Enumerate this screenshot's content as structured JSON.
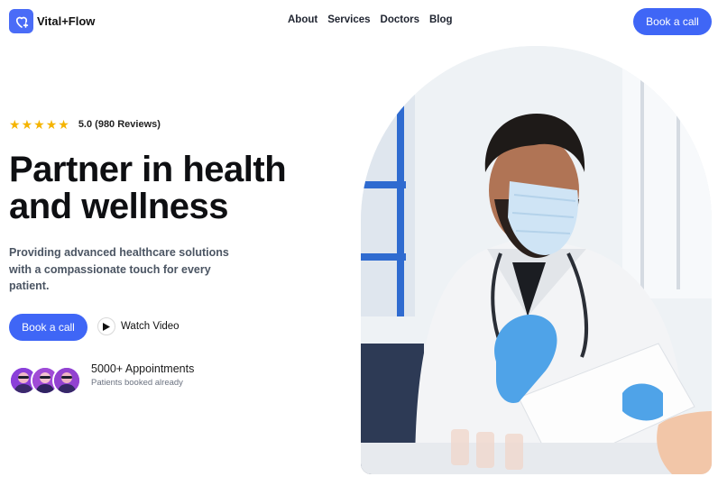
{
  "brand": {
    "name": "Vital+Flow",
    "icon": "heart-plus-icon",
    "color": "#4a6cf7"
  },
  "nav": {
    "items": [
      "About",
      "Services",
      "Doctors",
      "Blog"
    ]
  },
  "header": {
    "cta_label": "Book a call"
  },
  "hero": {
    "rating_text": "5.0 (980 Reviews)",
    "stars": 5,
    "title": "Partner in health and wellness",
    "subtitle": "Providing advanced healthcare solutions with a compassionate touch for every patient.",
    "cta_label": "Book a call",
    "video_label": "Watch Video",
    "appointments_title": "5000+ Appointments",
    "appointments_sub": "Patients booked already"
  },
  "colors": {
    "accent": "#3f66f6",
    "star": "#f5b400"
  }
}
